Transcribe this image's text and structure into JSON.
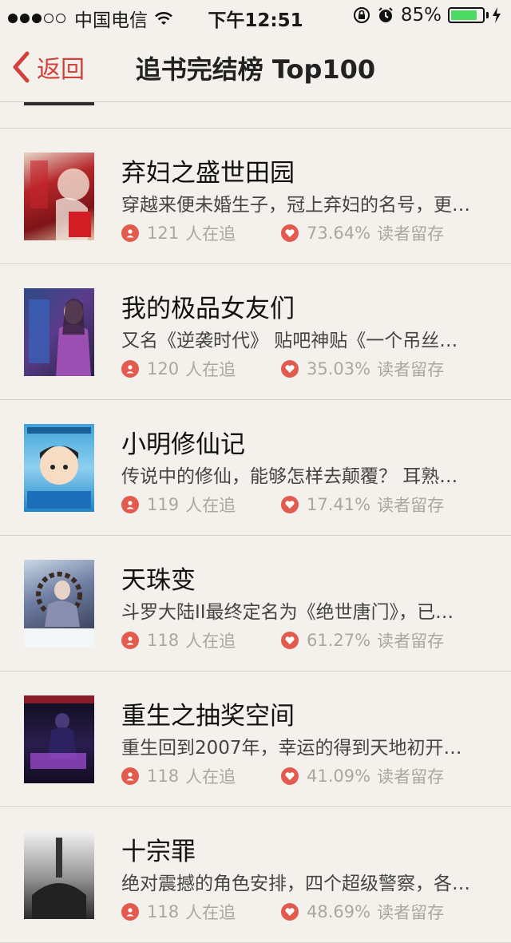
{
  "status_bar": {
    "signal": "●●●○○",
    "carrier": "中国电信",
    "time": "下午12:51",
    "battery_percent": "85%",
    "battery_level": 0.85
  },
  "nav": {
    "back_label": "返回",
    "title": "追书完结榜 Top100"
  },
  "colors": {
    "accent": "#d2413b",
    "background": "#f4f1ec",
    "icon_red": "#e35a4f",
    "battery_green": "#4cd964",
    "meta_gray": "#aaa6a0"
  },
  "books": [
    {
      "title": "弃妇之盛世田园",
      "description": "穿越来便未婚生子，冠上弃妇的名号，更…",
      "followers": "121",
      "followers_label": "人在追",
      "retention": "73.64%",
      "retention_label": "读者留存"
    },
    {
      "title": "我的极品女友们",
      "description": "又名《逆袭时代》 贴吧神贴《一个吊丝…",
      "followers": "120",
      "followers_label": "人在追",
      "retention": "35.03%",
      "retention_label": "读者留存"
    },
    {
      "title": "小明修仙记",
      "description": "传说中的修仙，能够怎样去颠覆？ 耳熟…",
      "followers": "119",
      "followers_label": "人在追",
      "retention": "17.41%",
      "retention_label": "读者留存"
    },
    {
      "title": "天珠变",
      "description": "斗罗大陆II最终定名为《绝世唐门》，已…",
      "followers": "118",
      "followers_label": "人在追",
      "retention": "61.27%",
      "retention_label": "读者留存"
    },
    {
      "title": "重生之抽奖空间",
      "description": "重生回到2007年，幸运的得到天地初开…",
      "followers": "118",
      "followers_label": "人在追",
      "retention": "41.09%",
      "retention_label": "读者留存"
    },
    {
      "title": "十宗罪",
      "description": "绝对震撼的角色安排，四个超级警察，各…",
      "followers": "118",
      "followers_label": "人在追",
      "retention": "48.69%",
      "retention_label": "读者留存"
    }
  ]
}
